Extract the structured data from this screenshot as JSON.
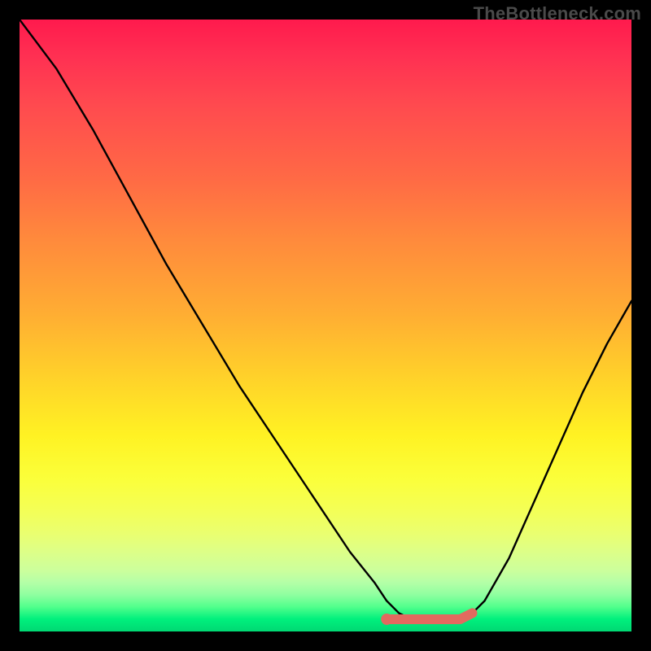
{
  "watermark": "TheBottleneck.com",
  "chart_data": {
    "type": "line",
    "title": "",
    "xlabel": "",
    "ylabel": "",
    "xlim": [
      0,
      100
    ],
    "ylim": [
      0,
      100
    ],
    "grid": false,
    "legend": false,
    "series": [
      {
        "name": "curve",
        "color": "#000000",
        "x": [
          0,
          6,
          12,
          18,
          24,
          30,
          36,
          42,
          48,
          54,
          58,
          60,
          62,
          64,
          66,
          68,
          70,
          72,
          74,
          76,
          80,
          84,
          88,
          92,
          96,
          100
        ],
        "values": [
          100,
          92,
          82,
          71,
          60,
          50,
          40,
          31,
          22,
          13,
          8,
          5,
          3,
          2,
          2,
          2,
          2,
          2,
          3,
          5,
          12,
          21,
          30,
          39,
          47,
          54
        ]
      },
      {
        "name": "trough-mark",
        "color": "#e26a5f",
        "style": "thick",
        "x": [
          60,
          62,
          64,
          66,
          68,
          70,
          72,
          74
        ],
        "values": [
          2,
          2,
          2,
          2,
          2,
          2,
          2,
          3
        ]
      }
    ],
    "gradient_stops": [
      {
        "pos": 0,
        "color": "#ff1a4d"
      },
      {
        "pos": 50,
        "color": "#ffc028"
      },
      {
        "pos": 70,
        "color": "#fff223"
      },
      {
        "pos": 100,
        "color": "#00d873"
      }
    ]
  }
}
